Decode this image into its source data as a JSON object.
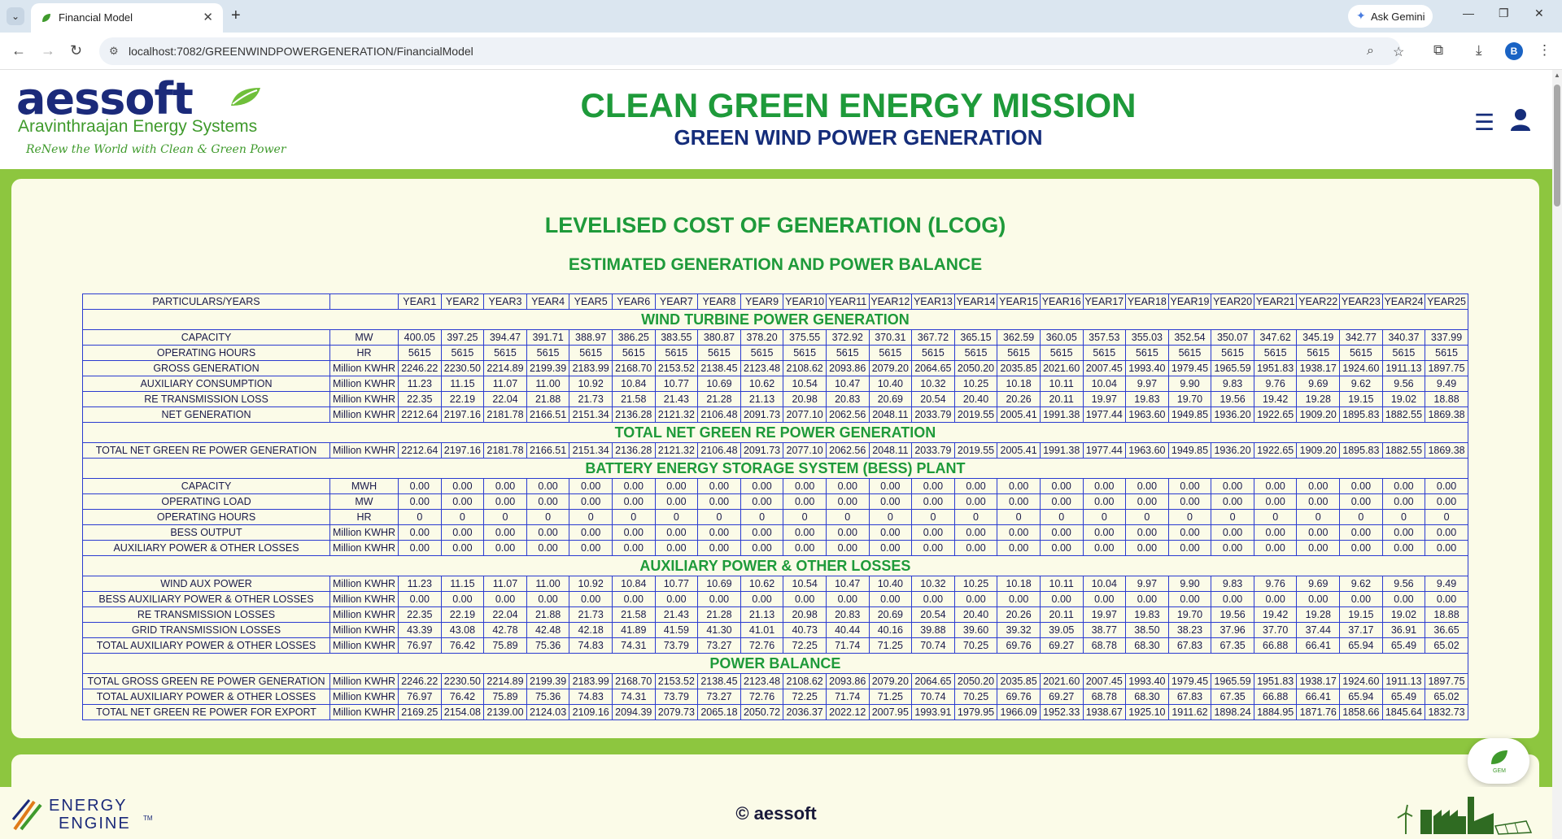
{
  "browser": {
    "tab_title": "Financial Model",
    "new_tab": "+",
    "tab_close": "✕",
    "gemini_label": "Ask Gemini",
    "url": "localhost:7082/GREENWINDPOWERGENERATION/FinancialModel",
    "profile_initial": "B"
  },
  "header": {
    "logo_text": "aessoft",
    "logo_subtitle": "Aravinthraajan Energy Systems",
    "logo_tagline": "ReNew the World with Clean & Green Power",
    "mission_title": "CLEAN GREEN ENERGY MISSION",
    "mission_subtitle": "GREEN WIND POWER GENERATION"
  },
  "report": {
    "title": "LEVELISED COST OF GENERATION (LCOG)",
    "subtitle": "ESTIMATED GENERATION AND POWER BALANCE",
    "header_label": "PARTICULARS/YEARS",
    "years": [
      "YEAR1",
      "YEAR2",
      "YEAR3",
      "YEAR4",
      "YEAR5",
      "YEAR6",
      "YEAR7",
      "YEAR8",
      "YEAR9",
      "YEAR10",
      "YEAR11",
      "YEAR12",
      "YEAR13",
      "YEAR14",
      "YEAR15",
      "YEAR16",
      "YEAR17",
      "YEAR18",
      "YEAR19",
      "YEAR20",
      "YEAR21",
      "YEAR22",
      "YEAR23",
      "YEAR24",
      "YEAR25"
    ],
    "sections": [
      {
        "title": "WIND TURBINE POWER GENERATION",
        "rows": [
          {
            "label": "CAPACITY",
            "unit": "MW",
            "values": [
              "400.05",
              "397.25",
              "394.47",
              "391.71",
              "388.97",
              "386.25",
              "383.55",
              "380.87",
              "378.20",
              "375.55",
              "372.92",
              "370.31",
              "367.72",
              "365.15",
              "362.59",
              "360.05",
              "357.53",
              "355.03",
              "352.54",
              "350.07",
              "347.62",
              "345.19",
              "342.77",
              "340.37",
              "337.99"
            ]
          },
          {
            "label": "OPERATING HOURS",
            "unit": "HR",
            "values": [
              "5615",
              "5615",
              "5615",
              "5615",
              "5615",
              "5615",
              "5615",
              "5615",
              "5615",
              "5615",
              "5615",
              "5615",
              "5615",
              "5615",
              "5615",
              "5615",
              "5615",
              "5615",
              "5615",
              "5615",
              "5615",
              "5615",
              "5615",
              "5615",
              "5615"
            ]
          },
          {
            "label": "GROSS GENERATION",
            "unit": "Million KWHR",
            "values": [
              "2246.22",
              "2230.50",
              "2214.89",
              "2199.39",
              "2183.99",
              "2168.70",
              "2153.52",
              "2138.45",
              "2123.48",
              "2108.62",
              "2093.86",
              "2079.20",
              "2064.65",
              "2050.20",
              "2035.85",
              "2021.60",
              "2007.45",
              "1993.40",
              "1979.45",
              "1965.59",
              "1951.83",
              "1938.17",
              "1924.60",
              "1911.13",
              "1897.75"
            ]
          },
          {
            "label": "AUXILIARY CONSUMPTION",
            "unit": "Million KWHR",
            "values": [
              "11.23",
              "11.15",
              "11.07",
              "11.00",
              "10.92",
              "10.84",
              "10.77",
              "10.69",
              "10.62",
              "10.54",
              "10.47",
              "10.40",
              "10.32",
              "10.25",
              "10.18",
              "10.11",
              "10.04",
              "9.97",
              "9.90",
              "9.83",
              "9.76",
              "9.69",
              "9.62",
              "9.56",
              "9.49"
            ]
          },
          {
            "label": "RE TRANSMISSION LOSS",
            "unit": "Million KWHR",
            "values": [
              "22.35",
              "22.19",
              "22.04",
              "21.88",
              "21.73",
              "21.58",
              "21.43",
              "21.28",
              "21.13",
              "20.98",
              "20.83",
              "20.69",
              "20.54",
              "20.40",
              "20.26",
              "20.11",
              "19.97",
              "19.83",
              "19.70",
              "19.56",
              "19.42",
              "19.28",
              "19.15",
              "19.02",
              "18.88"
            ]
          },
          {
            "label": "NET GENERATION",
            "unit": "Million KWHR",
            "values": [
              "2212.64",
              "2197.16",
              "2181.78",
              "2166.51",
              "2151.34",
              "2136.28",
              "2121.32",
              "2106.48",
              "2091.73",
              "2077.10",
              "2062.56",
              "2048.11",
              "2033.79",
              "2019.55",
              "2005.41",
              "1991.38",
              "1977.44",
              "1963.60",
              "1949.85",
              "1936.20",
              "1922.65",
              "1909.20",
              "1895.83",
              "1882.55",
              "1869.38"
            ]
          }
        ]
      },
      {
        "title": "TOTAL NET GREEN RE POWER GENERATION",
        "rows": [
          {
            "label": "TOTAL NET GREEN RE POWER GENERATION",
            "unit": "Million KWHR",
            "values": [
              "2212.64",
              "2197.16",
              "2181.78",
              "2166.51",
              "2151.34",
              "2136.28",
              "2121.32",
              "2106.48",
              "2091.73",
              "2077.10",
              "2062.56",
              "2048.11",
              "2033.79",
              "2019.55",
              "2005.41",
              "1991.38",
              "1977.44",
              "1963.60",
              "1949.85",
              "1936.20",
              "1922.65",
              "1909.20",
              "1895.83",
              "1882.55",
              "1869.38"
            ]
          }
        ]
      },
      {
        "title": "BATTERY ENERGY STORAGE SYSTEM (BESS) PLANT",
        "rows": [
          {
            "label": "CAPACITY",
            "unit": "MWH",
            "values": [
              "0.00",
              "0.00",
              "0.00",
              "0.00",
              "0.00",
              "0.00",
              "0.00",
              "0.00",
              "0.00",
              "0.00",
              "0.00",
              "0.00",
              "0.00",
              "0.00",
              "0.00",
              "0.00",
              "0.00",
              "0.00",
              "0.00",
              "0.00",
              "0.00",
              "0.00",
              "0.00",
              "0.00",
              "0.00"
            ]
          },
          {
            "label": "OPERATING LOAD",
            "unit": "MW",
            "values": [
              "0.00",
              "0.00",
              "0.00",
              "0.00",
              "0.00",
              "0.00",
              "0.00",
              "0.00",
              "0.00",
              "0.00",
              "0.00",
              "0.00",
              "0.00",
              "0.00",
              "0.00",
              "0.00",
              "0.00",
              "0.00",
              "0.00",
              "0.00",
              "0.00",
              "0.00",
              "0.00",
              "0.00",
              "0.00"
            ]
          },
          {
            "label": "OPERATING HOURS",
            "unit": "HR",
            "values": [
              "0",
              "0",
              "0",
              "0",
              "0",
              "0",
              "0",
              "0",
              "0",
              "0",
              "0",
              "0",
              "0",
              "0",
              "0",
              "0",
              "0",
              "0",
              "0",
              "0",
              "0",
              "0",
              "0",
              "0",
              "0"
            ]
          },
          {
            "label": "BESS OUTPUT",
            "unit": "Million KWHR",
            "values": [
              "0.00",
              "0.00",
              "0.00",
              "0.00",
              "0.00",
              "0.00",
              "0.00",
              "0.00",
              "0.00",
              "0.00",
              "0.00",
              "0.00",
              "0.00",
              "0.00",
              "0.00",
              "0.00",
              "0.00",
              "0.00",
              "0.00",
              "0.00",
              "0.00",
              "0.00",
              "0.00",
              "0.00",
              "0.00"
            ]
          },
          {
            "label": "AUXILIARY POWER & OTHER LOSSES",
            "unit": "Million KWHR",
            "values": [
              "0.00",
              "0.00",
              "0.00",
              "0.00",
              "0.00",
              "0.00",
              "0.00",
              "0.00",
              "0.00",
              "0.00",
              "0.00",
              "0.00",
              "0.00",
              "0.00",
              "0.00",
              "0.00",
              "0.00",
              "0.00",
              "0.00",
              "0.00",
              "0.00",
              "0.00",
              "0.00",
              "0.00",
              "0.00"
            ]
          }
        ]
      },
      {
        "title": "AUXILIARY POWER & OTHER LOSSES",
        "rows": [
          {
            "label": "WIND AUX POWER",
            "unit": "Million KWHR",
            "values": [
              "11.23",
              "11.15",
              "11.07",
              "11.00",
              "10.92",
              "10.84",
              "10.77",
              "10.69",
              "10.62",
              "10.54",
              "10.47",
              "10.40",
              "10.32",
              "10.25",
              "10.18",
              "10.11",
              "10.04",
              "9.97",
              "9.90",
              "9.83",
              "9.76",
              "9.69",
              "9.62",
              "9.56",
              "9.49"
            ]
          },
          {
            "label": "BESS AUXILIARY POWER & OTHER LOSSES",
            "unit": "Million KWHR",
            "values": [
              "0.00",
              "0.00",
              "0.00",
              "0.00",
              "0.00",
              "0.00",
              "0.00",
              "0.00",
              "0.00",
              "0.00",
              "0.00",
              "0.00",
              "0.00",
              "0.00",
              "0.00",
              "0.00",
              "0.00",
              "0.00",
              "0.00",
              "0.00",
              "0.00",
              "0.00",
              "0.00",
              "0.00",
              "0.00"
            ]
          },
          {
            "label": "RE TRANSMISSION LOSSES",
            "unit": "Million KWHR",
            "values": [
              "22.35",
              "22.19",
              "22.04",
              "21.88",
              "21.73",
              "21.58",
              "21.43",
              "21.28",
              "21.13",
              "20.98",
              "20.83",
              "20.69",
              "20.54",
              "20.40",
              "20.26",
              "20.11",
              "19.97",
              "19.83",
              "19.70",
              "19.56",
              "19.42",
              "19.28",
              "19.15",
              "19.02",
              "18.88"
            ]
          },
          {
            "label": "GRID TRANSMISSION LOSSES",
            "unit": "Million KWHR",
            "values": [
              "43.39",
              "43.08",
              "42.78",
              "42.48",
              "42.18",
              "41.89",
              "41.59",
              "41.30",
              "41.01",
              "40.73",
              "40.44",
              "40.16",
              "39.88",
              "39.60",
              "39.32",
              "39.05",
              "38.77",
              "38.50",
              "38.23",
              "37.96",
              "37.70",
              "37.44",
              "37.17",
              "36.91",
              "36.65"
            ]
          },
          {
            "label": "TOTAL AUXILIARY POWER & OTHER LOSSES",
            "unit": "Million KWHR",
            "values": [
              "76.97",
              "76.42",
              "75.89",
              "75.36",
              "74.83",
              "74.31",
              "73.79",
              "73.27",
              "72.76",
              "72.25",
              "71.74",
              "71.25",
              "70.74",
              "70.25",
              "69.76",
              "69.27",
              "68.78",
              "68.30",
              "67.83",
              "67.35",
              "66.88",
              "66.41",
              "65.94",
              "65.49",
              "65.02"
            ]
          }
        ]
      },
      {
        "title": "POWER BALANCE",
        "rows": [
          {
            "label": "TOTAL GROSS GREEN RE POWER GENERATION",
            "unit": "Million KWHR",
            "values": [
              "2246.22",
              "2230.50",
              "2214.89",
              "2199.39",
              "2183.99",
              "2168.70",
              "2153.52",
              "2138.45",
              "2123.48",
              "2108.62",
              "2093.86",
              "2079.20",
              "2064.65",
              "2050.20",
              "2035.85",
              "2021.60",
              "2007.45",
              "1993.40",
              "1979.45",
              "1965.59",
              "1951.83",
              "1938.17",
              "1924.60",
              "1911.13",
              "1897.75"
            ]
          },
          {
            "label": "TOTAL AUXILIARY POWER & OTHER LOSSES",
            "unit": "Million KWHR",
            "values": [
              "76.97",
              "76.42",
              "75.89",
              "75.36",
              "74.83",
              "74.31",
              "73.79",
              "73.27",
              "72.76",
              "72.25",
              "71.74",
              "71.25",
              "70.74",
              "70.25",
              "69.76",
              "69.27",
              "68.78",
              "68.30",
              "67.83",
              "67.35",
              "66.88",
              "66.41",
              "65.94",
              "65.49",
              "65.02"
            ]
          },
          {
            "label": "TOTAL NET GREEN RE POWER FOR EXPORT",
            "unit": "Million KWHR",
            "values": [
              "2169.25",
              "2154.08",
              "2139.00",
              "2124.03",
              "2109.16",
              "2094.39",
              "2079.73",
              "2065.18",
              "2050.72",
              "2036.37",
              "2022.12",
              "2007.95",
              "1993.91",
              "1979.95",
              "1966.09",
              "1952.33",
              "1938.67",
              "1925.10",
              "1911.62",
              "1898.24",
              "1884.95",
              "1871.76",
              "1858.66",
              "1845.64",
              "1832.73"
            ]
          }
        ]
      }
    ]
  },
  "footer": {
    "brand_line1": "ENERGY",
    "brand_line2": "ENGINE",
    "trademark": "TM",
    "copyright": "© aessoft",
    "chat_label": "GEM"
  },
  "colors": {
    "green_title": "#1e9a3a",
    "navy": "#152d7a",
    "page_green": "#8dc63f",
    "card_bg": "#fbfbe8",
    "table_border": "#2a3bd0"
  }
}
